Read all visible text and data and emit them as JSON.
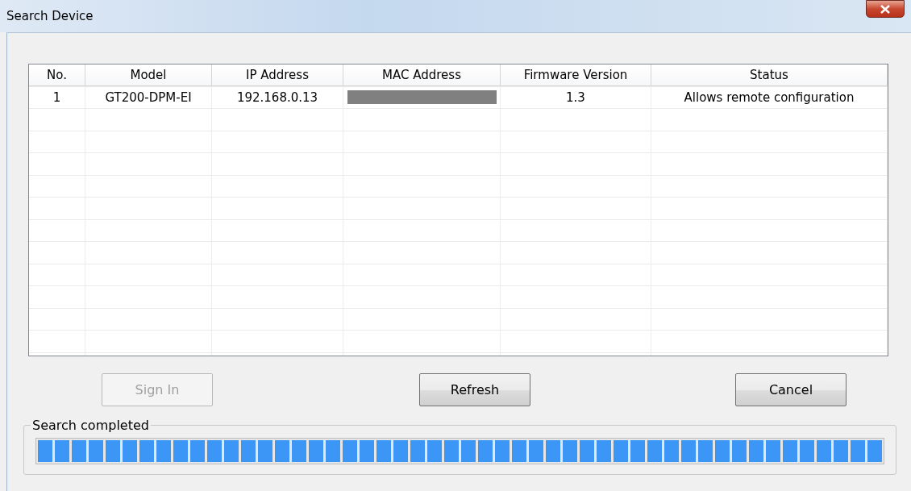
{
  "window": {
    "title": "Search Device"
  },
  "table": {
    "columns": [
      "No.",
      "Model",
      "IP Address",
      "MAC Address",
      "Firmware Version",
      "Status"
    ],
    "rows": [
      {
        "no": "1",
        "model": "GT200-DPM-EI",
        "ip": "192.168.0.13",
        "mac_redacted": true,
        "firmware": "1.3",
        "status": "Allows remote configuration"
      }
    ]
  },
  "buttons": [
    {
      "label": "Sign In",
      "disabled": true
    },
    {
      "label": "Refresh",
      "disabled": false
    },
    {
      "label": "Cancel",
      "disabled": false
    }
  ],
  "progress": {
    "label": "Search completed"
  }
}
